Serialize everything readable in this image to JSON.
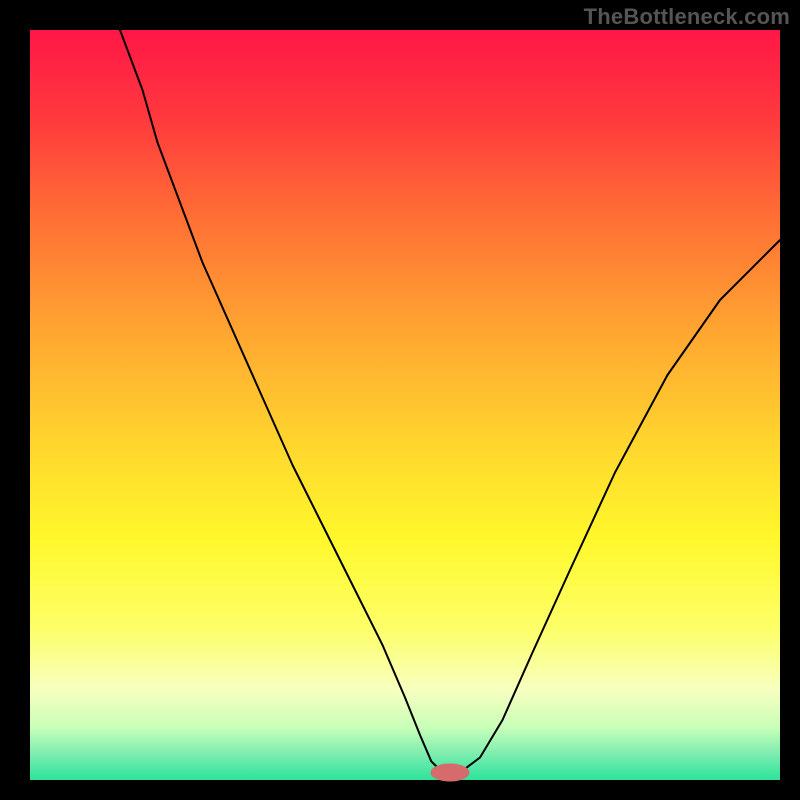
{
  "watermark": "TheBottleneck.com",
  "chart_data": {
    "type": "line",
    "title": "",
    "xlabel": "",
    "ylabel": "",
    "xlim": [
      0,
      100
    ],
    "ylim": [
      0,
      100
    ],
    "legend": null,
    "grid": false,
    "background_gradient": {
      "stops": [
        {
          "offset": 0.0,
          "color": "#ff1747"
        },
        {
          "offset": 0.12,
          "color": "#ff3a3d"
        },
        {
          "offset": 0.25,
          "color": "#ff6f35"
        },
        {
          "offset": 0.4,
          "color": "#ffa531"
        },
        {
          "offset": 0.55,
          "color": "#ffd52e"
        },
        {
          "offset": 0.68,
          "color": "#fff82c"
        },
        {
          "offset": 0.8,
          "color": "#fdff6a"
        },
        {
          "offset": 0.88,
          "color": "#f7ffc0"
        },
        {
          "offset": 0.93,
          "color": "#c8ffb8"
        },
        {
          "offset": 0.965,
          "color": "#7dedb0"
        },
        {
          "offset": 1.0,
          "color": "#2de39b"
        }
      ]
    },
    "marker": {
      "x": 56,
      "y": 99,
      "color": "#d66b6b",
      "rx": 2.6,
      "ry": 1.2
    },
    "series": [
      {
        "name": "bottleneck-curve",
        "color": "#000000",
        "stroke_width": 2,
        "x": [
          12,
          15,
          17,
          20,
          23,
          27,
          31,
          35,
          39,
          43,
          47,
          50,
          52,
          53.5,
          55,
          56,
          58,
          60,
          63,
          67,
          72,
          78,
          85,
          92,
          100
        ],
        "values": [
          100,
          92,
          85,
          77,
          69,
          60,
          51,
          42,
          34,
          26,
          18,
          11,
          6,
          2.5,
          1,
          1,
          1.5,
          3,
          8,
          17,
          28,
          41,
          54,
          64,
          72
        ]
      }
    ]
  }
}
